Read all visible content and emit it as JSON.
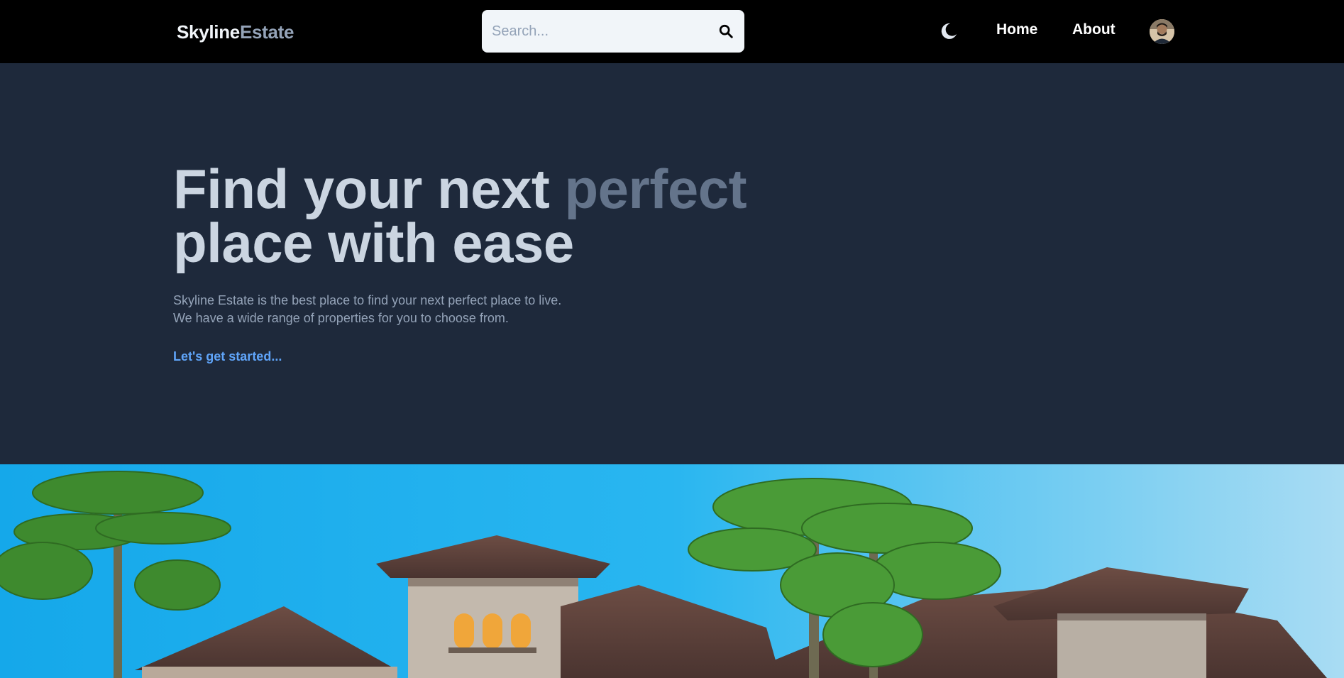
{
  "brand": {
    "part1": "Skyline",
    "part2": "Estate"
  },
  "search": {
    "placeholder": "Search...",
    "value": "",
    "icon": "search-icon"
  },
  "theme_toggle": {
    "icon": "moon-icon"
  },
  "nav": {
    "home": "Home",
    "about": "About"
  },
  "avatar": {
    "icon": "user-avatar"
  },
  "hero": {
    "title_part1": "Find your next ",
    "title_accent": "perfect",
    "title_part2": "place with ease",
    "desc_line1": "Skyline Estate is the best place to find your next perfect place to live.",
    "desc_line2": "We have a wide range of properties for you to choose from.",
    "cta": "Let's get started..."
  },
  "colors": {
    "header_bg": "#000000",
    "page_bg": "#1e293b",
    "title": "#cbd5e1",
    "title_accent": "#64748b",
    "text_muted": "#94a3b8",
    "link": "#60a5fa"
  }
}
